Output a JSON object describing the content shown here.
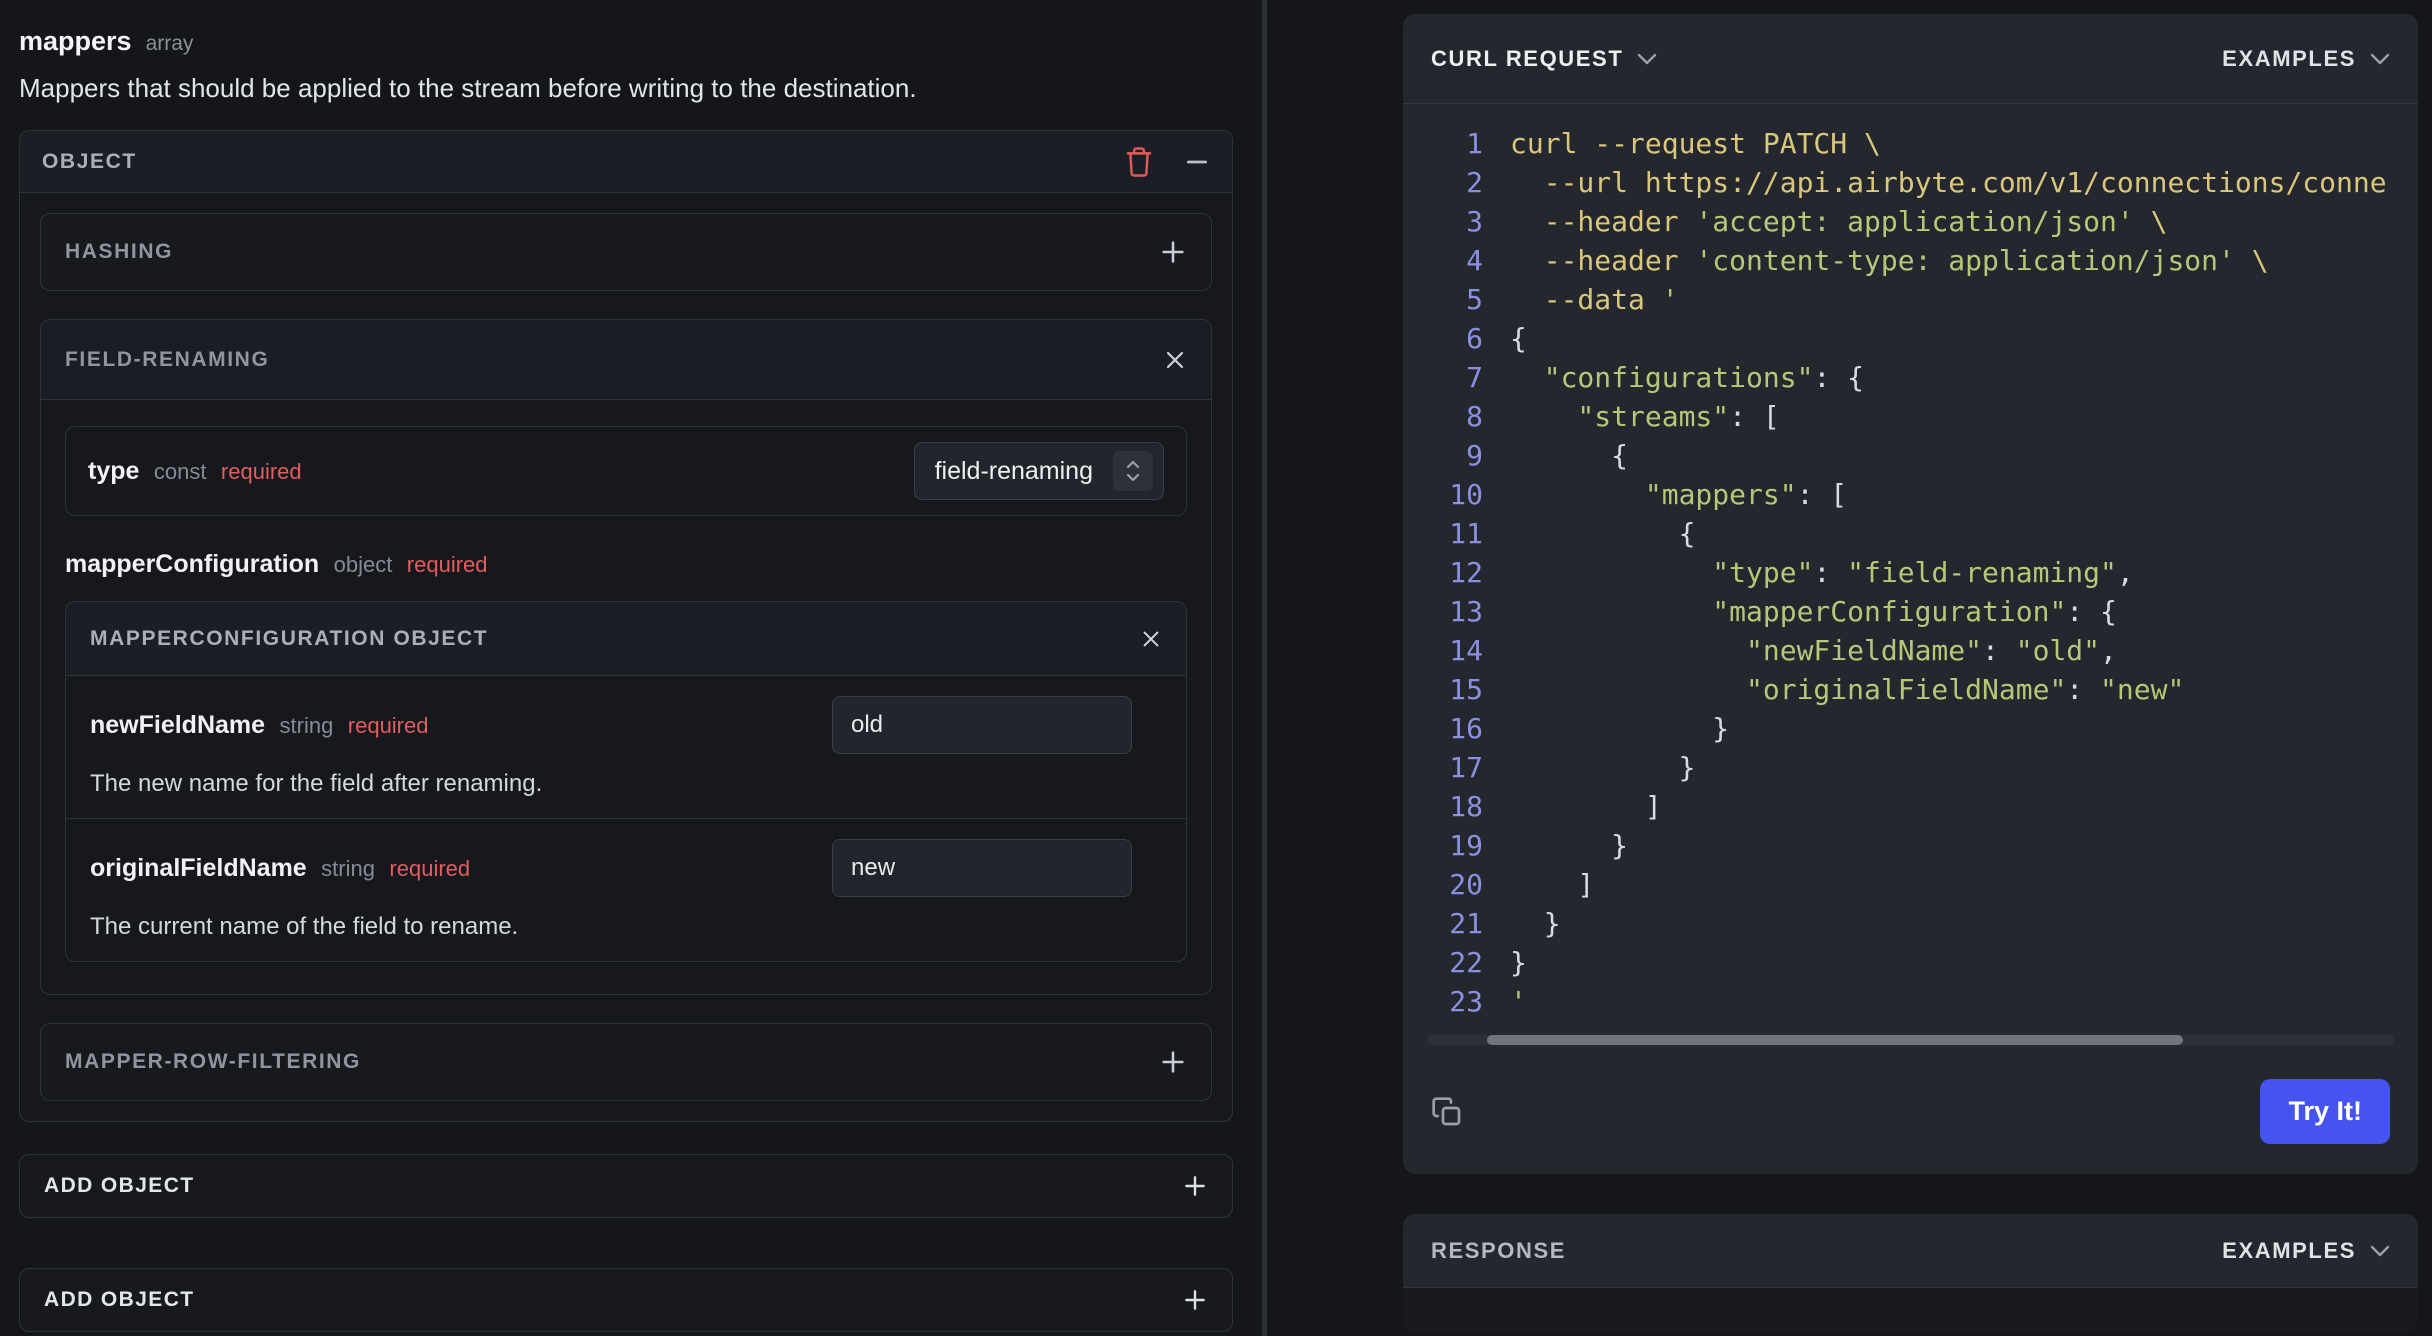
{
  "left": {
    "param": {
      "name": "mappers",
      "kind": "array",
      "description": "Mappers that should be applied to the stream before writing to the destination."
    },
    "object_card": {
      "title": "OBJECT"
    },
    "hashing": {
      "label": "HASHING"
    },
    "field_renaming": {
      "label": "FIELD-RENAMING",
      "type_row": {
        "name": "type",
        "kind": "const",
        "required": "required",
        "value": "field-renaming"
      }
    },
    "mapper_config": {
      "name": "mapperConfiguration",
      "kind": "object",
      "required": "required",
      "card_title": "MAPPERCONFIGURATION OBJECT",
      "fields": [
        {
          "name": "newFieldName",
          "kind": "string",
          "required": "required",
          "value": "old",
          "description": "The new name for the field after renaming."
        },
        {
          "name": "originalFieldName",
          "kind": "string",
          "required": "required",
          "value": "new",
          "description": "The current name of the field to rename."
        }
      ]
    },
    "row_filtering": {
      "label": "MAPPER-ROW-FILTERING"
    },
    "add_object_inner": "ADD OBJECT",
    "add_object_outer": "ADD OBJECT"
  },
  "right": {
    "curl_panel": {
      "title": "CURL REQUEST",
      "examples_label": "EXAMPLES",
      "try_it_label": "Try It!",
      "code": [
        {
          "n": 1,
          "t": [
            [
              "c",
              "curl --request PATCH \\"
            ]
          ]
        },
        {
          "n": 2,
          "t": [
            [
              "c",
              "  --url https://api.airbyte.com/v1/connections/conne"
            ]
          ]
        },
        {
          "n": 3,
          "t": [
            [
              "c",
              "  --header "
            ],
            [
              "s",
              "'accept: application/json'"
            ],
            [
              "c",
              " \\"
            ]
          ]
        },
        {
          "n": 4,
          "t": [
            [
              "c",
              "  --header "
            ],
            [
              "s",
              "'content-type: application/json'"
            ],
            [
              "c",
              " \\"
            ]
          ]
        },
        {
          "n": 5,
          "t": [
            [
              "c",
              "  --data "
            ],
            [
              "s",
              "'"
            ]
          ]
        },
        {
          "n": 6,
          "t": [
            [
              "p",
              "{"
            ]
          ]
        },
        {
          "n": 7,
          "t": [
            [
              "s",
              "  \"configurations\""
            ],
            [
              "p",
              ": {"
            ]
          ]
        },
        {
          "n": 8,
          "t": [
            [
              "s",
              "    \"streams\""
            ],
            [
              "p",
              ": ["
            ]
          ]
        },
        {
          "n": 9,
          "t": [
            [
              "p",
              "      {"
            ]
          ]
        },
        {
          "n": 10,
          "t": [
            [
              "s",
              "        \"mappers\""
            ],
            [
              "p",
              ": ["
            ]
          ]
        },
        {
          "n": 11,
          "t": [
            [
              "p",
              "          {"
            ]
          ]
        },
        {
          "n": 12,
          "t": [
            [
              "s",
              "            \"type\""
            ],
            [
              "p",
              ": "
            ],
            [
              "s",
              "\"field-renaming\""
            ],
            [
              "p",
              ","
            ]
          ]
        },
        {
          "n": 13,
          "t": [
            [
              "s",
              "            \"mapperConfiguration\""
            ],
            [
              "p",
              ": {"
            ]
          ]
        },
        {
          "n": 14,
          "t": [
            [
              "s",
              "              \"newFieldName\""
            ],
            [
              "p",
              ": "
            ],
            [
              "s",
              "\"old\""
            ],
            [
              "p",
              ","
            ]
          ]
        },
        {
          "n": 15,
          "t": [
            [
              "s",
              "              \"originalFieldName\""
            ],
            [
              "p",
              ": "
            ],
            [
              "s",
              "\"new\""
            ]
          ]
        },
        {
          "n": 16,
          "t": [
            [
              "p",
              "            }"
            ]
          ]
        },
        {
          "n": 17,
          "t": [
            [
              "p",
              "          }"
            ]
          ]
        },
        {
          "n": 18,
          "t": [
            [
              "p",
              "        ]"
            ]
          ]
        },
        {
          "n": 19,
          "t": [
            [
              "p",
              "      }"
            ]
          ]
        },
        {
          "n": 20,
          "t": [
            [
              "p",
              "    ]"
            ]
          ]
        },
        {
          "n": 21,
          "t": [
            [
              "p",
              "  }"
            ]
          ]
        },
        {
          "n": 22,
          "t": [
            [
              "p",
              "}"
            ]
          ]
        },
        {
          "n": 23,
          "t": [
            [
              "s",
              "'"
            ]
          ]
        }
      ]
    },
    "response_panel": {
      "title": "RESPONSE",
      "examples_label": "EXAMPLES"
    }
  },
  "colors": {
    "accent_blue": "#4553ef",
    "required_red": "#e25d5d",
    "line_number_purple": "#8b90e2"
  }
}
